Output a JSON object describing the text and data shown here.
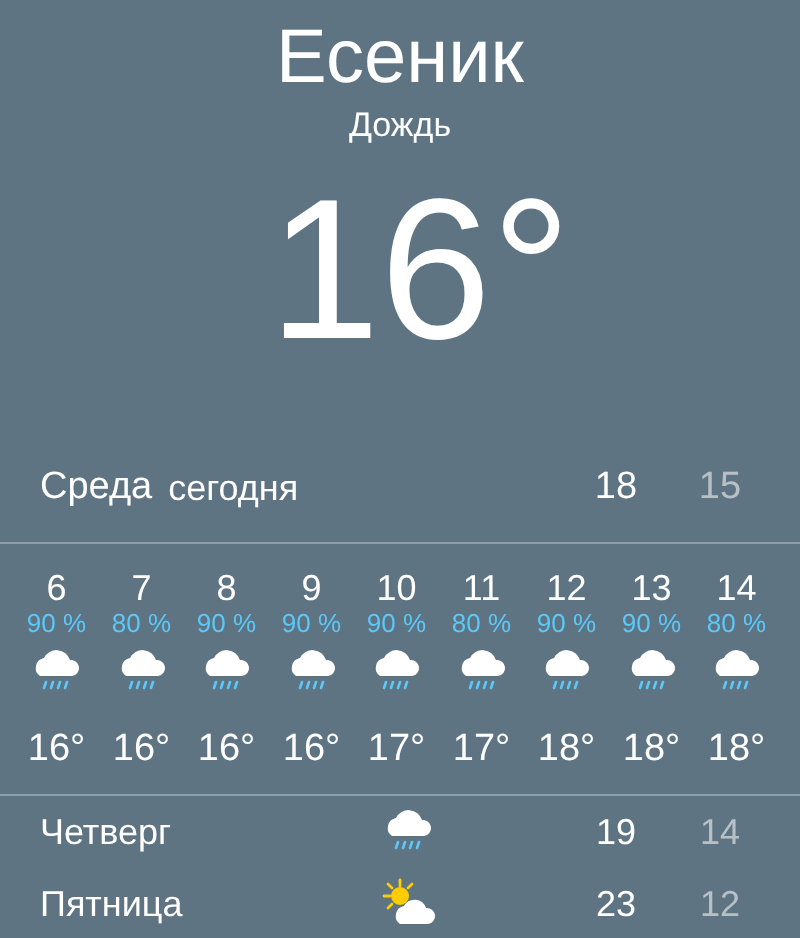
{
  "location": {
    "city": "Есеник",
    "condition": "Дождь",
    "temperature": "16°"
  },
  "today": {
    "day": "Среда",
    "label": "сегодня",
    "high": "18",
    "low": "15"
  },
  "hourly": [
    {
      "hour": "6",
      "precipitation": "90 %",
      "kind": "rain",
      "temperature": "16°"
    },
    {
      "hour": "7",
      "precipitation": "80 %",
      "kind": "rain",
      "temperature": "16°"
    },
    {
      "hour": "8",
      "precipitation": "90 %",
      "kind": "rain",
      "temperature": "16°"
    },
    {
      "hour": "9",
      "precipitation": "90 %",
      "kind": "rain",
      "temperature": "16°"
    },
    {
      "hour": "10",
      "precipitation": "90 %",
      "kind": "rain",
      "temperature": "17°"
    },
    {
      "hour": "11",
      "precipitation": "80 %",
      "kind": "rain",
      "temperature": "17°"
    },
    {
      "hour": "12",
      "precipitation": "90 %",
      "kind": "rain",
      "temperature": "18°"
    },
    {
      "hour": "13",
      "precipitation": "90 %",
      "kind": "rain",
      "temperature": "18°"
    },
    {
      "hour": "14",
      "precipitation": "80 %",
      "kind": "rain",
      "temperature": "18°"
    }
  ],
  "daily": [
    {
      "day": "Четверг",
      "kind": "rain",
      "high": "19",
      "low": "14"
    },
    {
      "day": "Пятница",
      "kind": "partly-sunny",
      "high": "23",
      "low": "12"
    }
  ]
}
